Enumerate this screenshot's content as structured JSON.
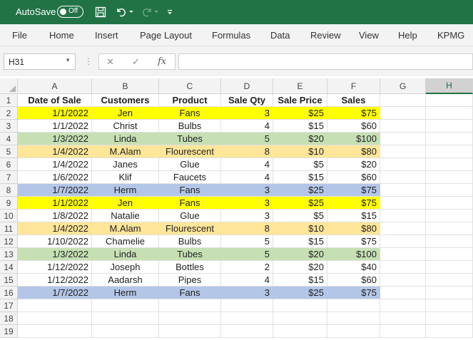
{
  "titlebar": {
    "autosave_label": "AutoSave",
    "autosave_state": "Off"
  },
  "ribbon": {
    "tabs": [
      "File",
      "Home",
      "Insert",
      "Page Layout",
      "Formulas",
      "Data",
      "Review",
      "View",
      "Help",
      "KPMG"
    ]
  },
  "formula_bar": {
    "name_box": "H31",
    "formula": "",
    "fx_label": "fx"
  },
  "sheet": {
    "columns": [
      "A",
      "B",
      "C",
      "D",
      "E",
      "F",
      "G",
      "H"
    ],
    "selected_column": "H",
    "rows": [
      "1",
      "2",
      "3",
      "4",
      "5",
      "6",
      "7",
      "8",
      "9",
      "10",
      "11",
      "12",
      "13",
      "14",
      "15",
      "16",
      "17",
      "18",
      "19"
    ],
    "colors": {
      "yellow": "#ffff00",
      "green": "#c6e0b4",
      "orange": "#ffe699",
      "blue": "#b4c6e7",
      "none": "#ffffff"
    },
    "headers": [
      "Date of Sale",
      "Customers",
      "Product",
      "Sale Qty",
      "Sale Price",
      "Sales"
    ],
    "data": [
      {
        "date": "1/1/2022",
        "customer": "Jen",
        "product": "Fans",
        "qty": "3",
        "price": "$25",
        "sales": "$75",
        "fill": "yellow"
      },
      {
        "date": "1/1/2022",
        "customer": "Christ",
        "product": "Bulbs",
        "qty": "4",
        "price": "$15",
        "sales": "$60",
        "fill": "none"
      },
      {
        "date": "1/3/2022",
        "customer": "Linda",
        "product": "Tubes",
        "qty": "5",
        "price": "$20",
        "sales": "$100",
        "fill": "green"
      },
      {
        "date": "1/4/2022",
        "customer": "M.Alam",
        "product": "Flourescent",
        "qty": "8",
        "price": "$10",
        "sales": "$80",
        "fill": "orange"
      },
      {
        "date": "1/4/2022",
        "customer": "Janes",
        "product": "Glue",
        "qty": "4",
        "price": "$5",
        "sales": "$20",
        "fill": "none"
      },
      {
        "date": "1/6/2022",
        "customer": "Klif",
        "product": "Faucets",
        "qty": "4",
        "price": "$15",
        "sales": "$60",
        "fill": "none"
      },
      {
        "date": "1/7/2022",
        "customer": "Herm",
        "product": "Fans",
        "qty": "3",
        "price": "$25",
        "sales": "$75",
        "fill": "blue"
      },
      {
        "date": "1/1/2022",
        "customer": "Jen",
        "product": "Fans",
        "qty": "3",
        "price": "$25",
        "sales": "$75",
        "fill": "yellow"
      },
      {
        "date": "1/8/2022",
        "customer": "Natalie",
        "product": "Glue",
        "qty": "3",
        "price": "$5",
        "sales": "$15",
        "fill": "none"
      },
      {
        "date": "1/4/2022",
        "customer": "M.Alam",
        "product": "Flourescent",
        "qty": "8",
        "price": "$10",
        "sales": "$80",
        "fill": "orange"
      },
      {
        "date": "1/10/2022",
        "customer": "Chamelie",
        "product": "Bulbs",
        "qty": "5",
        "price": "$15",
        "sales": "$75",
        "fill": "none"
      },
      {
        "date": "1/3/2022",
        "customer": "Linda",
        "product": "Tubes",
        "qty": "5",
        "price": "$20",
        "sales": "$100",
        "fill": "green"
      },
      {
        "date": "1/12/2022",
        "customer": "Joseph",
        "product": "Bottles",
        "qty": "2",
        "price": "$20",
        "sales": "$40",
        "fill": "none"
      },
      {
        "date": "1/12/2022",
        "customer": "Aadarsh",
        "product": "Pipes",
        "qty": "4",
        "price": "$15",
        "sales": "$60",
        "fill": "none"
      },
      {
        "date": "1/7/2022",
        "customer": "Herm",
        "product": "Fans",
        "qty": "3",
        "price": "$25",
        "sales": "$75",
        "fill": "blue"
      }
    ]
  }
}
